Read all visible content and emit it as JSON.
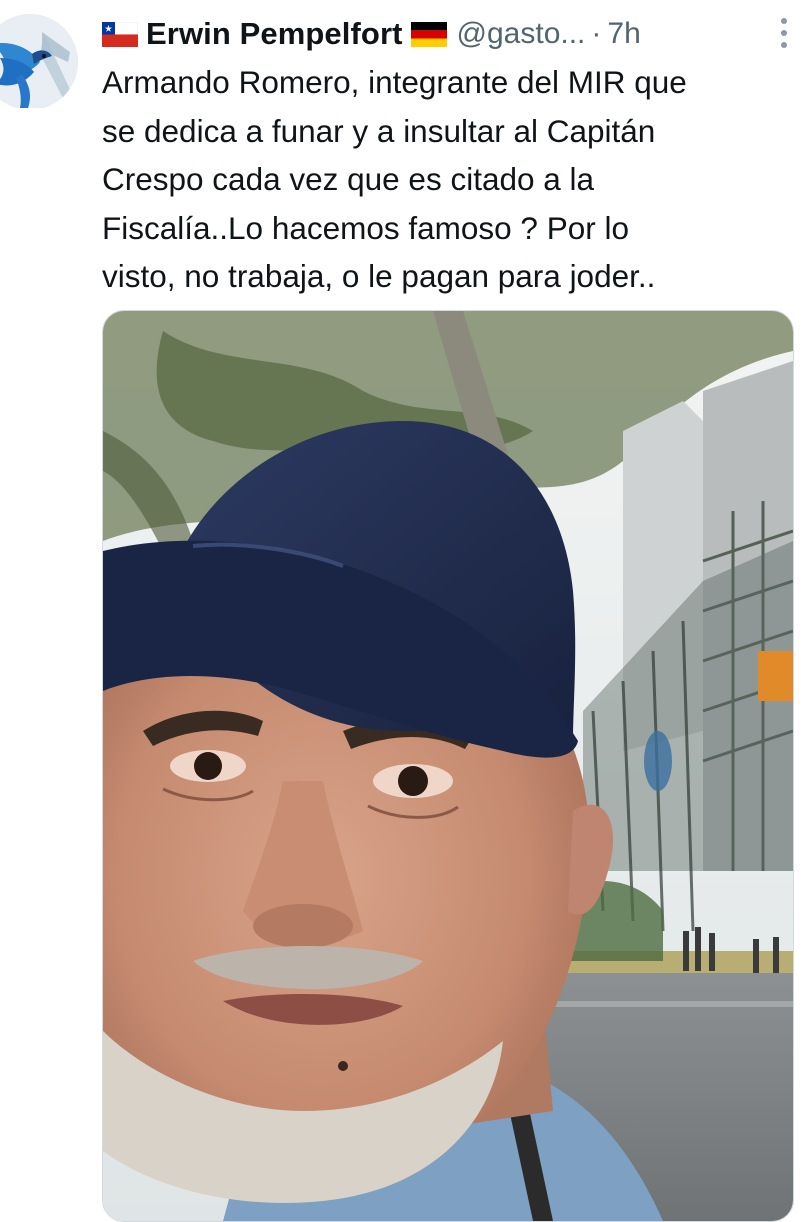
{
  "tweet": {
    "author": {
      "display_name": "Erwin Pempelfort",
      "handle": "@gasto...",
      "flag_before": "chile-flag-icon",
      "flag_after": "germany-flag-icon",
      "avatar": "blue-bird-avatar"
    },
    "separator": "·",
    "time": "7h",
    "more_icon": "more-vertical-icon",
    "text_lines": [
      "Armando Romero, integrante del MIR que",
      "se dedica a funar y a insultar al Capitán",
      "Crespo cada vez que es citado a la",
      "Fiscalía..Lo hacemos famoso ? Por lo",
      "visto, no trabaja, o le pagan para joder.."
    ],
    "media": {
      "type": "photo",
      "description_icon": "video-thumbnail"
    }
  },
  "colors": {
    "text": "#0f1419",
    "secondary": "#536471",
    "cap": "#1f2c52",
    "sky": "#e9eef0"
  }
}
